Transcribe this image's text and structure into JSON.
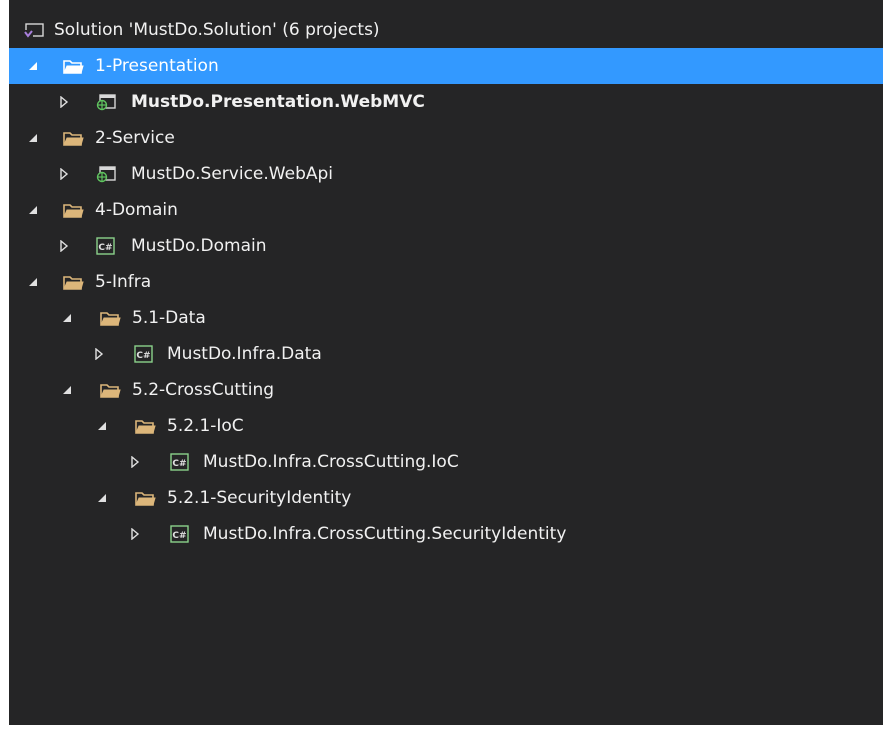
{
  "solution": {
    "label": "Solution 'MustDo.Solution' (6 projects)"
  },
  "tree": {
    "presentation_folder": "1-Presentation",
    "webmvc_project": "MustDo.Presentation.WebMVC",
    "service_folder": "2-Service",
    "webapi_project": "MustDo.Service.WebApi",
    "domain_folder": "4-Domain",
    "domain_project": "MustDo.Domain",
    "infra_folder": "5-Infra",
    "data_folder": "5.1-Data",
    "data_project": "MustDo.Infra.Data",
    "crosscutting_folder": "5.2-CrossCutting",
    "ioc_folder": "5.2.1-IoC",
    "ioc_project": "MustDo.Infra.CrossCutting.IoC",
    "security_folder": "5.2.1-SecurityIdentity",
    "security_project": "MustDo.Infra.CrossCutting.SecurityIdentity"
  },
  "colors": {
    "background": "#252526",
    "selection": "#3399ff",
    "text": "#f1f1f1",
    "csharp_icon": "#8bd18b",
    "web_icon": "#5fc45f"
  }
}
